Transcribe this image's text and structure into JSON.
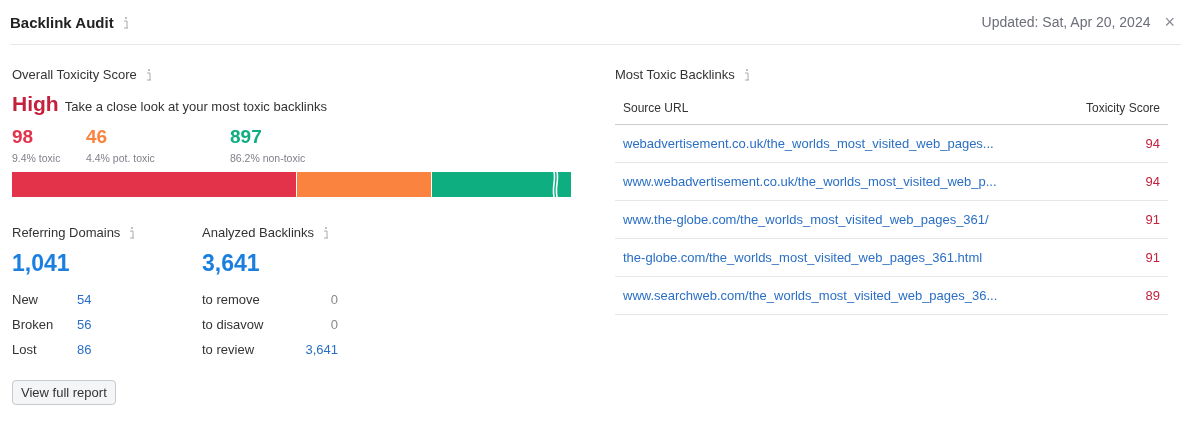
{
  "header": {
    "title": "Backlink Audit",
    "updated": "Updated: Sat, Apr 20, 2024",
    "close": "×"
  },
  "toxicity": {
    "title": "Overall Toxicity Score",
    "level_label": "High",
    "message": "Take a close look at your most toxic backlinks",
    "stats": [
      {
        "value": "98",
        "caption": "9.4% toxic",
        "color": "#e3334a"
      },
      {
        "value": "46",
        "caption": "4.4% pot. toxic",
        "color": "#fa8340"
      },
      {
        "value": "897",
        "caption": "86.2% non-toxic",
        "color": "#0fae80"
      }
    ]
  },
  "referring_domains": {
    "title": "Referring Domains",
    "total": "1,041",
    "rows": [
      {
        "label": "New",
        "value": "54"
      },
      {
        "label": "Broken",
        "value": "56"
      },
      {
        "label": "Lost",
        "value": "86"
      }
    ]
  },
  "analyzed_backlinks": {
    "title": "Analyzed Backlinks",
    "total": "3,641",
    "rows": [
      {
        "label": "to remove",
        "value": "0",
        "link": false
      },
      {
        "label": "to disavow",
        "value": "0",
        "link": false
      },
      {
        "label": "to review",
        "value": "3,641",
        "link": true
      }
    ]
  },
  "button": "View full report",
  "most_toxic": {
    "title": "Most Toxic Backlinks",
    "columns": [
      "Source URL",
      "Toxicity Score"
    ],
    "rows": [
      {
        "url": "webadvertisement.co.uk/the_worlds_most_visited_web_pages...",
        "score": "94"
      },
      {
        "url": "www.webadvertisement.co.uk/the_worlds_most_visited_web_p...",
        "score": "94"
      },
      {
        "url": "www.the-globe.com/the_worlds_most_visited_web_pages_361/",
        "score": "91"
      },
      {
        "url": "the-globe.com/the_worlds_most_visited_web_pages_361.html",
        "score": "91"
      },
      {
        "url": "www.searchweb.com/the_worlds_most_visited_web_pages_36...",
        "score": "89"
      }
    ]
  }
}
